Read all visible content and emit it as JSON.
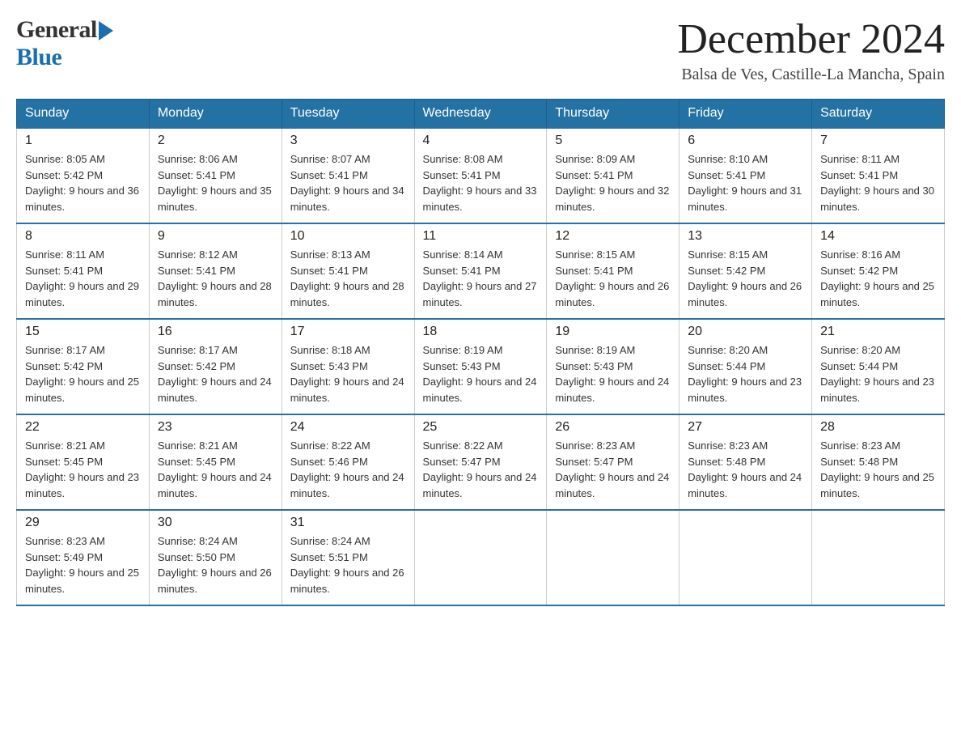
{
  "header": {
    "logo_general": "General",
    "logo_blue": "Blue",
    "month_title": "December 2024",
    "location": "Balsa de Ves, Castille-La Mancha, Spain"
  },
  "days_of_week": [
    "Sunday",
    "Monday",
    "Tuesday",
    "Wednesday",
    "Thursday",
    "Friday",
    "Saturday"
  ],
  "weeks": [
    [
      {
        "day": "1",
        "sunrise": "Sunrise: 8:05 AM",
        "sunset": "Sunset: 5:42 PM",
        "daylight": "Daylight: 9 hours and 36 minutes."
      },
      {
        "day": "2",
        "sunrise": "Sunrise: 8:06 AM",
        "sunset": "Sunset: 5:41 PM",
        "daylight": "Daylight: 9 hours and 35 minutes."
      },
      {
        "day": "3",
        "sunrise": "Sunrise: 8:07 AM",
        "sunset": "Sunset: 5:41 PM",
        "daylight": "Daylight: 9 hours and 34 minutes."
      },
      {
        "day": "4",
        "sunrise": "Sunrise: 8:08 AM",
        "sunset": "Sunset: 5:41 PM",
        "daylight": "Daylight: 9 hours and 33 minutes."
      },
      {
        "day": "5",
        "sunrise": "Sunrise: 8:09 AM",
        "sunset": "Sunset: 5:41 PM",
        "daylight": "Daylight: 9 hours and 32 minutes."
      },
      {
        "day": "6",
        "sunrise": "Sunrise: 8:10 AM",
        "sunset": "Sunset: 5:41 PM",
        "daylight": "Daylight: 9 hours and 31 minutes."
      },
      {
        "day": "7",
        "sunrise": "Sunrise: 8:11 AM",
        "sunset": "Sunset: 5:41 PM",
        "daylight": "Daylight: 9 hours and 30 minutes."
      }
    ],
    [
      {
        "day": "8",
        "sunrise": "Sunrise: 8:11 AM",
        "sunset": "Sunset: 5:41 PM",
        "daylight": "Daylight: 9 hours and 29 minutes."
      },
      {
        "day": "9",
        "sunrise": "Sunrise: 8:12 AM",
        "sunset": "Sunset: 5:41 PM",
        "daylight": "Daylight: 9 hours and 28 minutes."
      },
      {
        "day": "10",
        "sunrise": "Sunrise: 8:13 AM",
        "sunset": "Sunset: 5:41 PM",
        "daylight": "Daylight: 9 hours and 28 minutes."
      },
      {
        "day": "11",
        "sunrise": "Sunrise: 8:14 AM",
        "sunset": "Sunset: 5:41 PM",
        "daylight": "Daylight: 9 hours and 27 minutes."
      },
      {
        "day": "12",
        "sunrise": "Sunrise: 8:15 AM",
        "sunset": "Sunset: 5:41 PM",
        "daylight": "Daylight: 9 hours and 26 minutes."
      },
      {
        "day": "13",
        "sunrise": "Sunrise: 8:15 AM",
        "sunset": "Sunset: 5:42 PM",
        "daylight": "Daylight: 9 hours and 26 minutes."
      },
      {
        "day": "14",
        "sunrise": "Sunrise: 8:16 AM",
        "sunset": "Sunset: 5:42 PM",
        "daylight": "Daylight: 9 hours and 25 minutes."
      }
    ],
    [
      {
        "day": "15",
        "sunrise": "Sunrise: 8:17 AM",
        "sunset": "Sunset: 5:42 PM",
        "daylight": "Daylight: 9 hours and 25 minutes."
      },
      {
        "day": "16",
        "sunrise": "Sunrise: 8:17 AM",
        "sunset": "Sunset: 5:42 PM",
        "daylight": "Daylight: 9 hours and 24 minutes."
      },
      {
        "day": "17",
        "sunrise": "Sunrise: 8:18 AM",
        "sunset": "Sunset: 5:43 PM",
        "daylight": "Daylight: 9 hours and 24 minutes."
      },
      {
        "day": "18",
        "sunrise": "Sunrise: 8:19 AM",
        "sunset": "Sunset: 5:43 PM",
        "daylight": "Daylight: 9 hours and 24 minutes."
      },
      {
        "day": "19",
        "sunrise": "Sunrise: 8:19 AM",
        "sunset": "Sunset: 5:43 PM",
        "daylight": "Daylight: 9 hours and 24 minutes."
      },
      {
        "day": "20",
        "sunrise": "Sunrise: 8:20 AM",
        "sunset": "Sunset: 5:44 PM",
        "daylight": "Daylight: 9 hours and 23 minutes."
      },
      {
        "day": "21",
        "sunrise": "Sunrise: 8:20 AM",
        "sunset": "Sunset: 5:44 PM",
        "daylight": "Daylight: 9 hours and 23 minutes."
      }
    ],
    [
      {
        "day": "22",
        "sunrise": "Sunrise: 8:21 AM",
        "sunset": "Sunset: 5:45 PM",
        "daylight": "Daylight: 9 hours and 23 minutes."
      },
      {
        "day": "23",
        "sunrise": "Sunrise: 8:21 AM",
        "sunset": "Sunset: 5:45 PM",
        "daylight": "Daylight: 9 hours and 24 minutes."
      },
      {
        "day": "24",
        "sunrise": "Sunrise: 8:22 AM",
        "sunset": "Sunset: 5:46 PM",
        "daylight": "Daylight: 9 hours and 24 minutes."
      },
      {
        "day": "25",
        "sunrise": "Sunrise: 8:22 AM",
        "sunset": "Sunset: 5:47 PM",
        "daylight": "Daylight: 9 hours and 24 minutes."
      },
      {
        "day": "26",
        "sunrise": "Sunrise: 8:23 AM",
        "sunset": "Sunset: 5:47 PM",
        "daylight": "Daylight: 9 hours and 24 minutes."
      },
      {
        "day": "27",
        "sunrise": "Sunrise: 8:23 AM",
        "sunset": "Sunset: 5:48 PM",
        "daylight": "Daylight: 9 hours and 24 minutes."
      },
      {
        "day": "28",
        "sunrise": "Sunrise: 8:23 AM",
        "sunset": "Sunset: 5:48 PM",
        "daylight": "Daylight: 9 hours and 25 minutes."
      }
    ],
    [
      {
        "day": "29",
        "sunrise": "Sunrise: 8:23 AM",
        "sunset": "Sunset: 5:49 PM",
        "daylight": "Daylight: 9 hours and 25 minutes."
      },
      {
        "day": "30",
        "sunrise": "Sunrise: 8:24 AM",
        "sunset": "Sunset: 5:50 PM",
        "daylight": "Daylight: 9 hours and 26 minutes."
      },
      {
        "day": "31",
        "sunrise": "Sunrise: 8:24 AM",
        "sunset": "Sunset: 5:51 PM",
        "daylight": "Daylight: 9 hours and 26 minutes."
      },
      {
        "day": "",
        "sunrise": "",
        "sunset": "",
        "daylight": ""
      },
      {
        "day": "",
        "sunrise": "",
        "sunset": "",
        "daylight": ""
      },
      {
        "day": "",
        "sunrise": "",
        "sunset": "",
        "daylight": ""
      },
      {
        "day": "",
        "sunrise": "",
        "sunset": "",
        "daylight": ""
      }
    ]
  ]
}
